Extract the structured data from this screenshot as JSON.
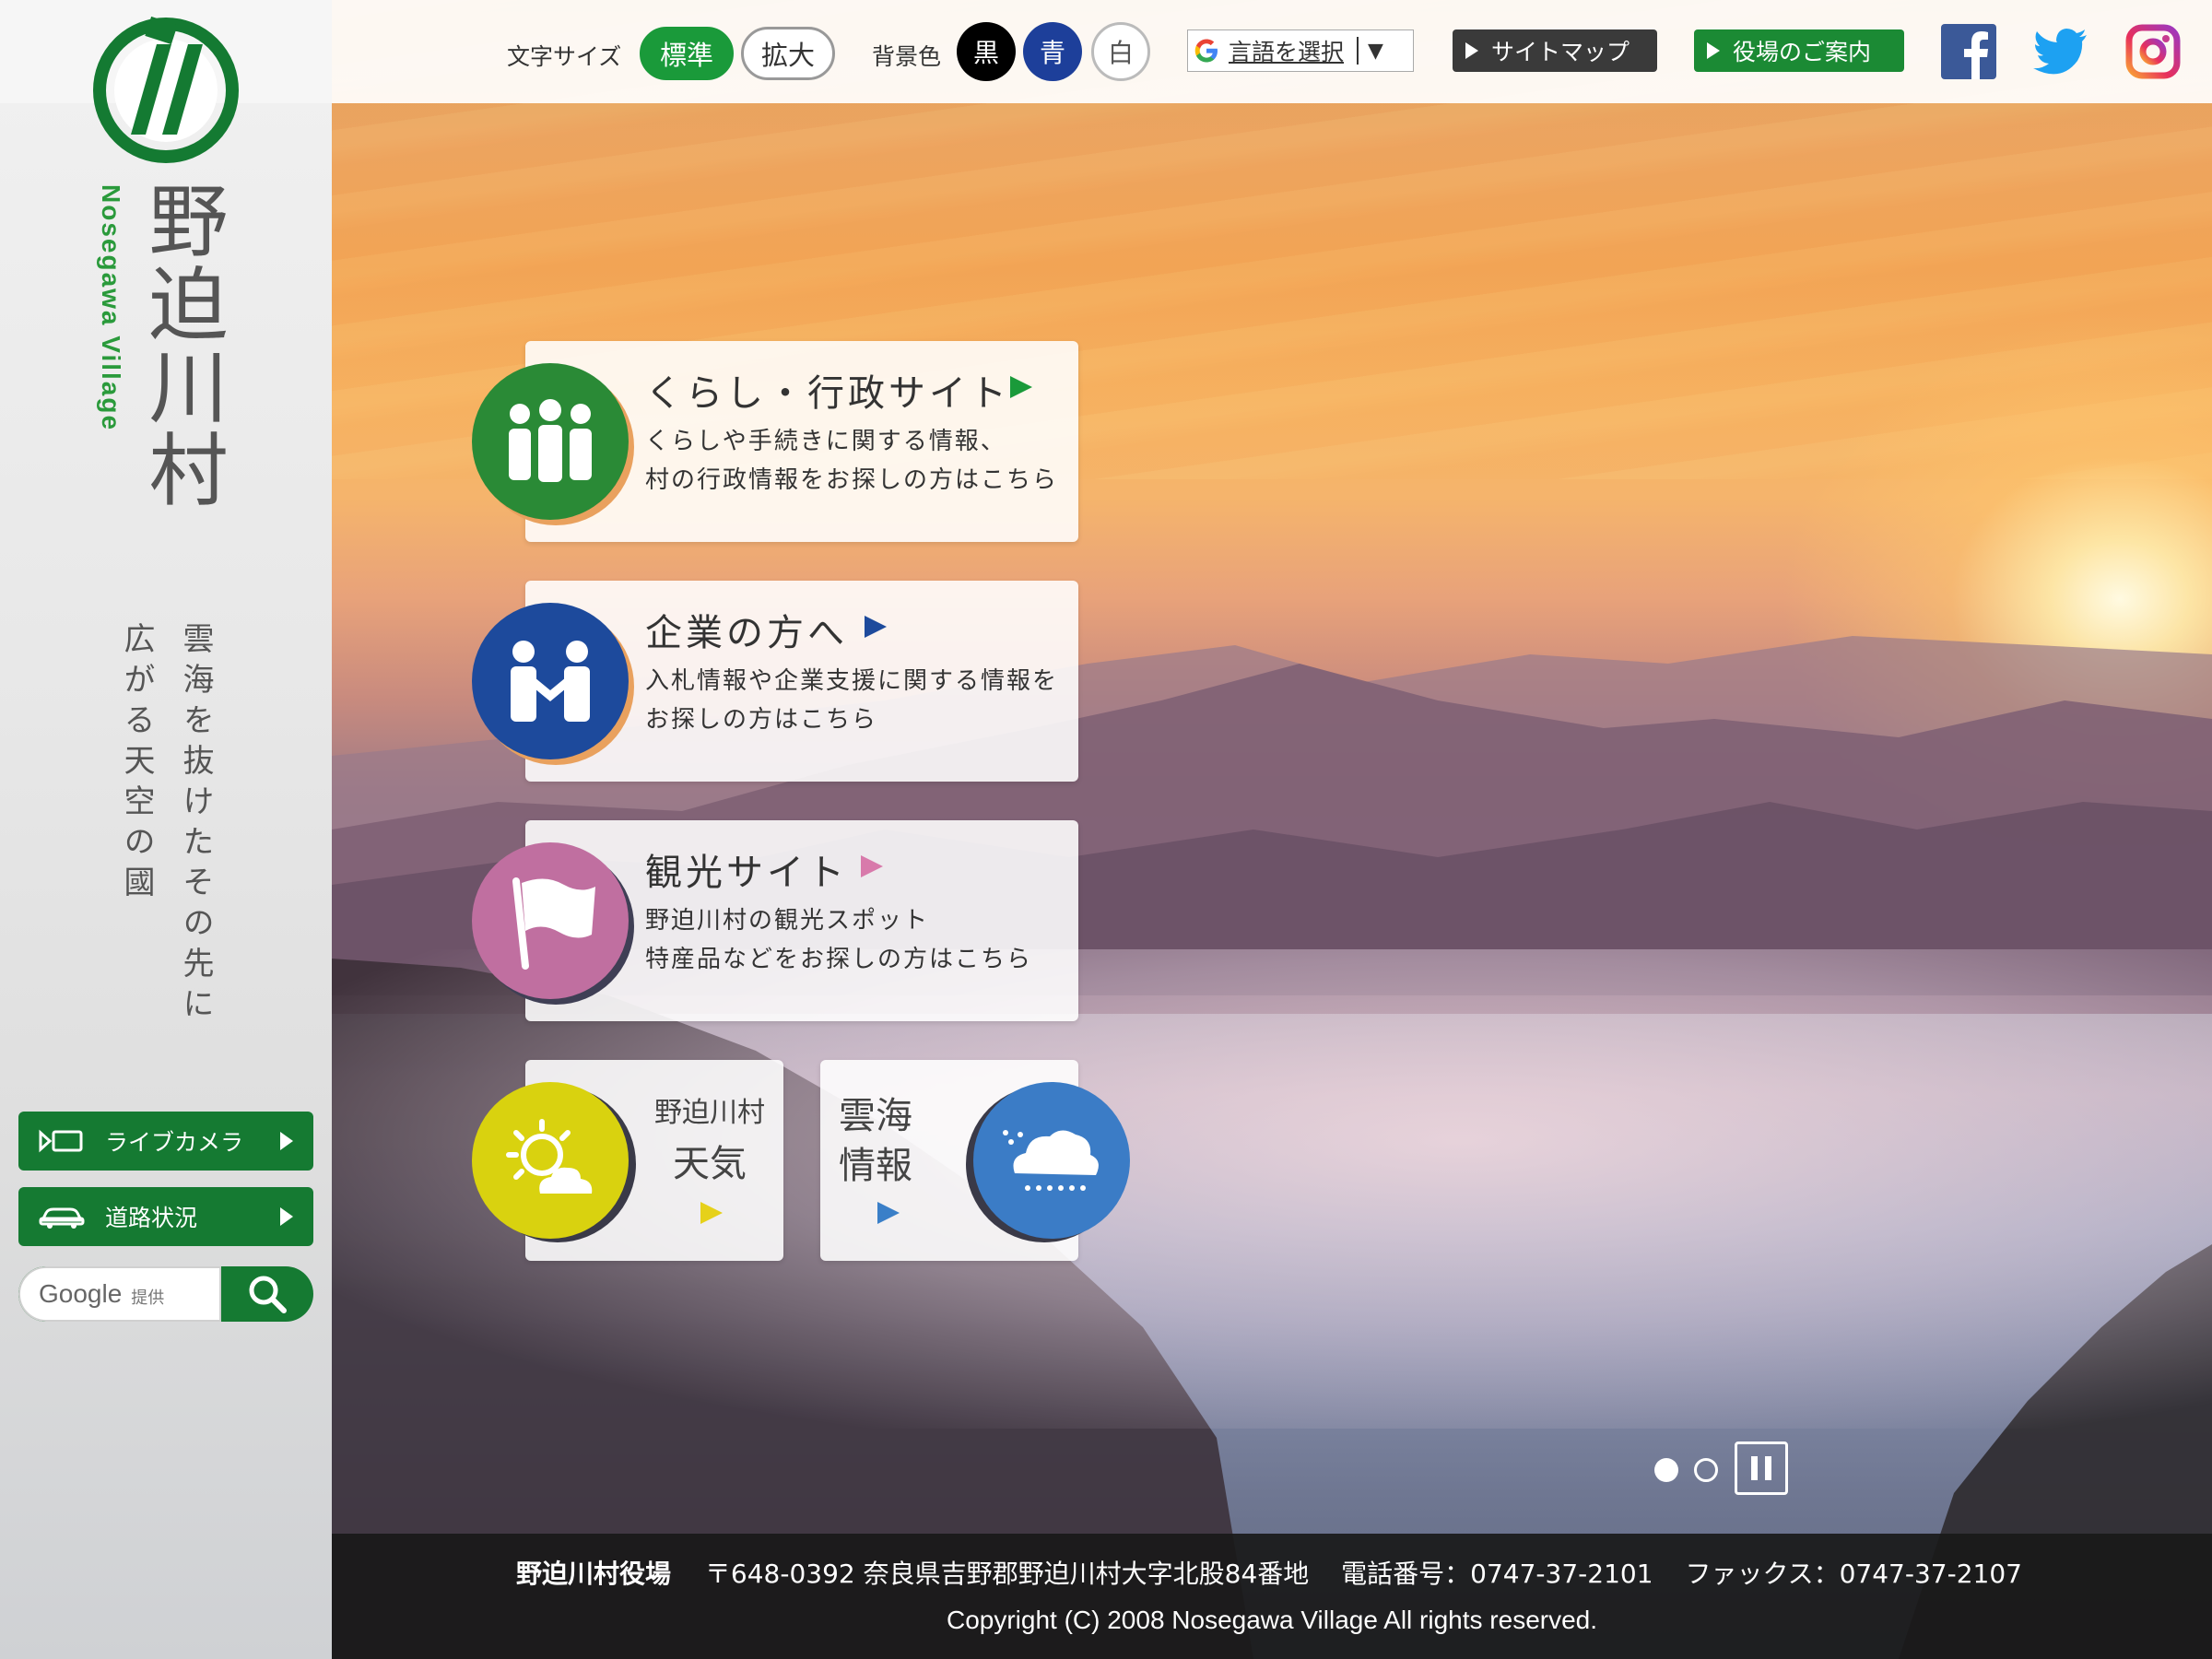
{
  "sidebar": {
    "title_ja": "野迫川村",
    "title_en": "Nosegawa Village",
    "tagline_line1": "雲海を抜けたその先に",
    "tagline_line2": "広がる天空の國",
    "buttons": [
      {
        "label": "ライブカメラ",
        "icon": "video-camera-icon"
      },
      {
        "label": "道路状況",
        "icon": "car-icon"
      }
    ],
    "search": {
      "brand": "Google",
      "provided": "提供",
      "icon": "search-icon"
    }
  },
  "topbar": {
    "font_size_label": "文字サイズ",
    "font_size_options": [
      "標準",
      "拡大"
    ],
    "bg_color_label": "背景色",
    "bg_color_options": [
      "黒",
      "青",
      "白"
    ],
    "language_select": "言語を選択",
    "sitemap": "サイトマップ",
    "office_guide": "役場のご案内",
    "social": [
      "facebook-icon",
      "twitter-icon",
      "instagram-icon"
    ]
  },
  "cards": [
    {
      "title": "くらし・行政サイト",
      "desc1": "くらしや手続きに関する情報、",
      "desc2": "村の行政情報をお探しの方はこちら",
      "color": "#2a8a36",
      "arrow": "#1a9a3a",
      "icon": "people-icon"
    },
    {
      "title": "企業の方へ",
      "desc1": "入札情報や企業支援に関する情報を",
      "desc2": "お探しの方はこちら",
      "color": "#1d4a9c",
      "arrow": "#1d4a9c",
      "icon": "handshake-icon"
    },
    {
      "title": "観光サイト",
      "desc1": "野迫川村の観光スポット",
      "desc2": "特産品などをお探しの方はこちら",
      "color": "#c06fa0",
      "arrow": "#d87aab",
      "icon": "flag-icon"
    }
  ],
  "weather": {
    "line1": "野迫川村",
    "line2": "天気",
    "color": "#d9d20f",
    "arrow": "#e6d11a",
    "icon": "sun-cloud-icon"
  },
  "cloudsea": {
    "line1": "雲海",
    "line2": "情報",
    "color": "#3b7cc6",
    "arrow": "#3a7fc8",
    "icon": "cloud-snow-icon"
  },
  "slider": {
    "slides": 2,
    "active": 1
  },
  "footer": {
    "office_name": "野迫川村役場",
    "address": "〒648-0392 奈良県吉野郡野迫川村大字北股84番地",
    "phone": "電話番号：0747-37-2101",
    "fax": "ファックス：0747-37-2107",
    "copyright": "Copyright (C) 2008 Nosegawa Village All rights reserved."
  }
}
